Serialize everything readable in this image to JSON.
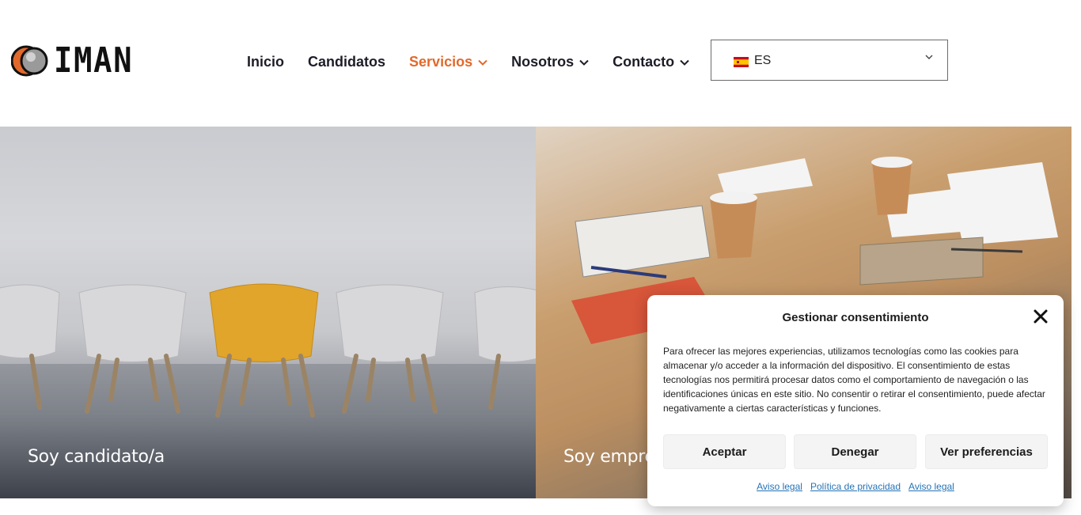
{
  "logo": {
    "text": "IMAN"
  },
  "nav": {
    "items": [
      {
        "label": "Inicio",
        "has_dropdown": false,
        "active": false
      },
      {
        "label": "Candidatos",
        "has_dropdown": false,
        "active": false
      },
      {
        "label": "Servicios",
        "has_dropdown": true,
        "active": true
      },
      {
        "label": "Nosotros",
        "has_dropdown": true,
        "active": false
      },
      {
        "label": "Contacto",
        "has_dropdown": true,
        "active": false
      }
    ],
    "active_color": "#e2692b",
    "text_color": "#1d1d28"
  },
  "language": {
    "selected": "ES",
    "flag_icon": "spain-flag-icon"
  },
  "hero": {
    "left_label": "Soy candidato/a",
    "right_label": "Soy empre"
  },
  "consent": {
    "title": "Gestionar consentimiento",
    "body": "Para ofrecer las mejores experiencias, utilizamos tecnologías como las cookies para almacenar y/o acceder a la información del dispositivo. El consentimiento de estas tecnologías nos permitirá procesar datos como el comportamiento de navegación o las identificaciones únicas en este sitio. No consentir o retirar el consentimiento, puede afectar negativamente a ciertas características y funciones.",
    "buttons": {
      "accept": "Aceptar",
      "deny": "Denegar",
      "preferences": "Ver preferencias"
    },
    "links": [
      "Aviso legal",
      "Política de privacidad",
      "Aviso legal"
    ],
    "link_color": "#2573b7"
  }
}
